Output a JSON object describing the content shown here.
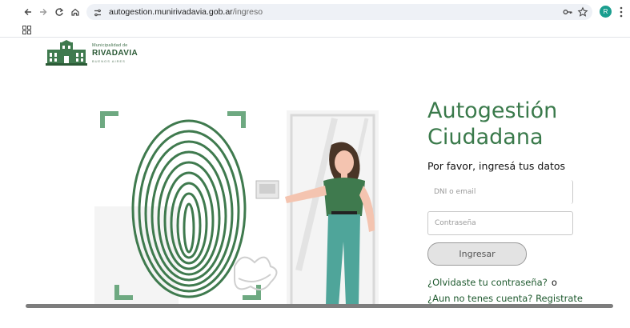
{
  "browser": {
    "url_domain": "autogestion.munirivadavia.gob.ar",
    "url_path": "/ingreso",
    "profile_initial": "R"
  },
  "logo": {
    "line1": "Municipalidad de",
    "line2": "RIVADAVIA",
    "line3": "BUENOS AIRES"
  },
  "login": {
    "title_line1": "Autogestión",
    "title_line2": "Ciudadana",
    "subtitle": "Por favor, ingresá tus datos",
    "dni_placeholder": "DNI o email",
    "password_placeholder": "Contraseña",
    "submit_label": "Ingresar",
    "forgot_link": "¿Olvidaste tu contraseña?",
    "or_text": "o",
    "register_link": "¿Aun no tenes cuenta? Registrate"
  },
  "colors": {
    "brand_green": "#3a7a4b",
    "link_green": "#1f5a2f",
    "illustration_green": "#3f7a4e",
    "button_bg": "#e3e3e3"
  },
  "icons": [
    "back-arrow-icon",
    "forward-arrow-icon",
    "reload-icon",
    "home-icon",
    "site-info-icon",
    "password-key-icon",
    "bookmark-star-icon",
    "menu-dots-icon",
    "apps-grid-icon"
  ]
}
